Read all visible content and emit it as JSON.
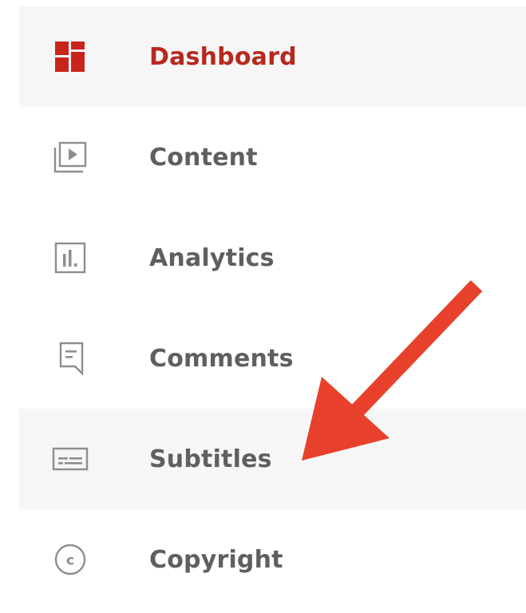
{
  "sidebar": {
    "items": [
      {
        "label": "Dashboard",
        "icon": "dashboard-icon",
        "state": "active"
      },
      {
        "label": "Content",
        "icon": "content-video-icon",
        "state": ""
      },
      {
        "label": "Analytics",
        "icon": "analytics-bar-chart-icon",
        "state": ""
      },
      {
        "label": "Comments",
        "icon": "comments-bubble-icon",
        "state": ""
      },
      {
        "label": "Subtitles",
        "icon": "subtitles-icon",
        "state": "hover"
      },
      {
        "label": "Copyright",
        "icon": "copyright-icon",
        "state": ""
      }
    ]
  },
  "annotation": {
    "type": "arrow",
    "color": "#e8412b",
    "points_to": "Subtitles"
  },
  "colors": {
    "accent": "#c8241c",
    "text": "#5f5f5f",
    "icon": "#8e8e8e",
    "hover_background": "#f6f6f6"
  }
}
